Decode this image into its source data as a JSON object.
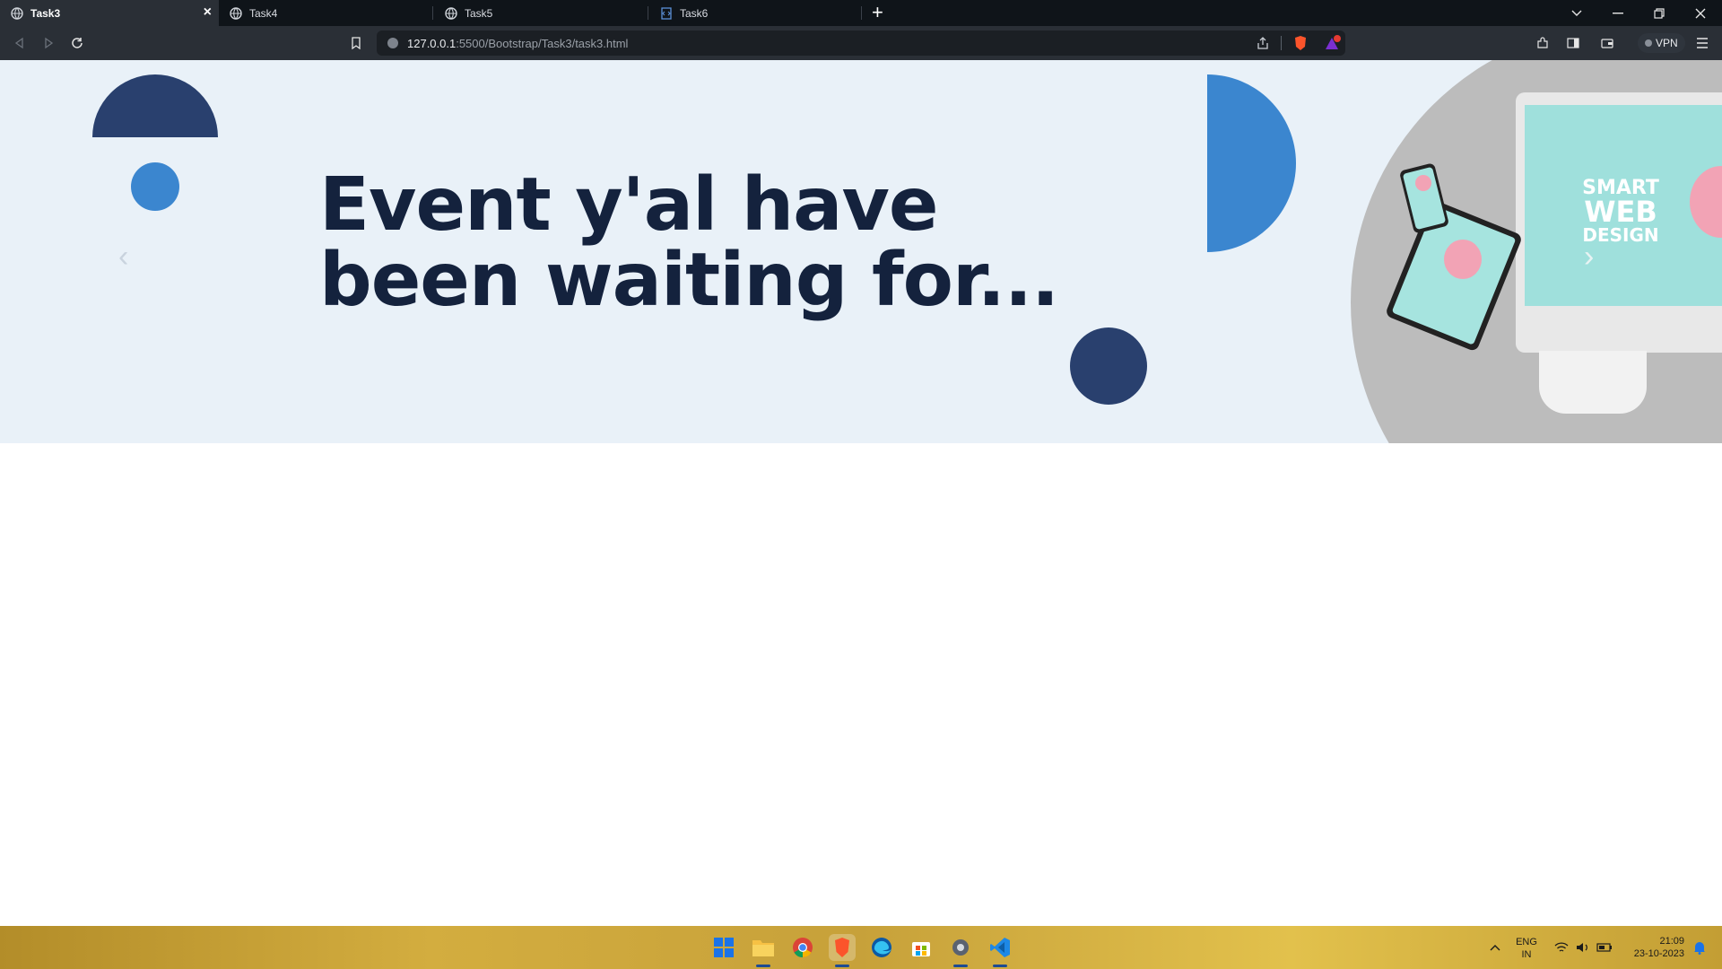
{
  "browser": {
    "tabs": [
      {
        "label": "Task3",
        "active": true
      },
      {
        "label": "Task4",
        "active": false
      },
      {
        "label": "Task5",
        "active": false
      },
      {
        "label": "Task6",
        "active": false
      }
    ],
    "url_host": "127.0.0.1",
    "url_rest": ":5500/Bootstrap/Task3/task3.html",
    "vpn_label": "VPN"
  },
  "page": {
    "headline_line1": "Event y'al have",
    "headline_line2": "been waiting for...",
    "product": {
      "line1": "SMART",
      "line2": "WEB",
      "line3": "DESIGN"
    }
  },
  "taskbar": {
    "lang_top": "ENG",
    "lang_bottom": "IN",
    "time": "21:09",
    "date": "23-10-2023"
  },
  "colors": {
    "hero_bg": "#e9f1f8",
    "navy": "#29406e",
    "blue": "#3b86cf",
    "headline": "#14223d"
  }
}
